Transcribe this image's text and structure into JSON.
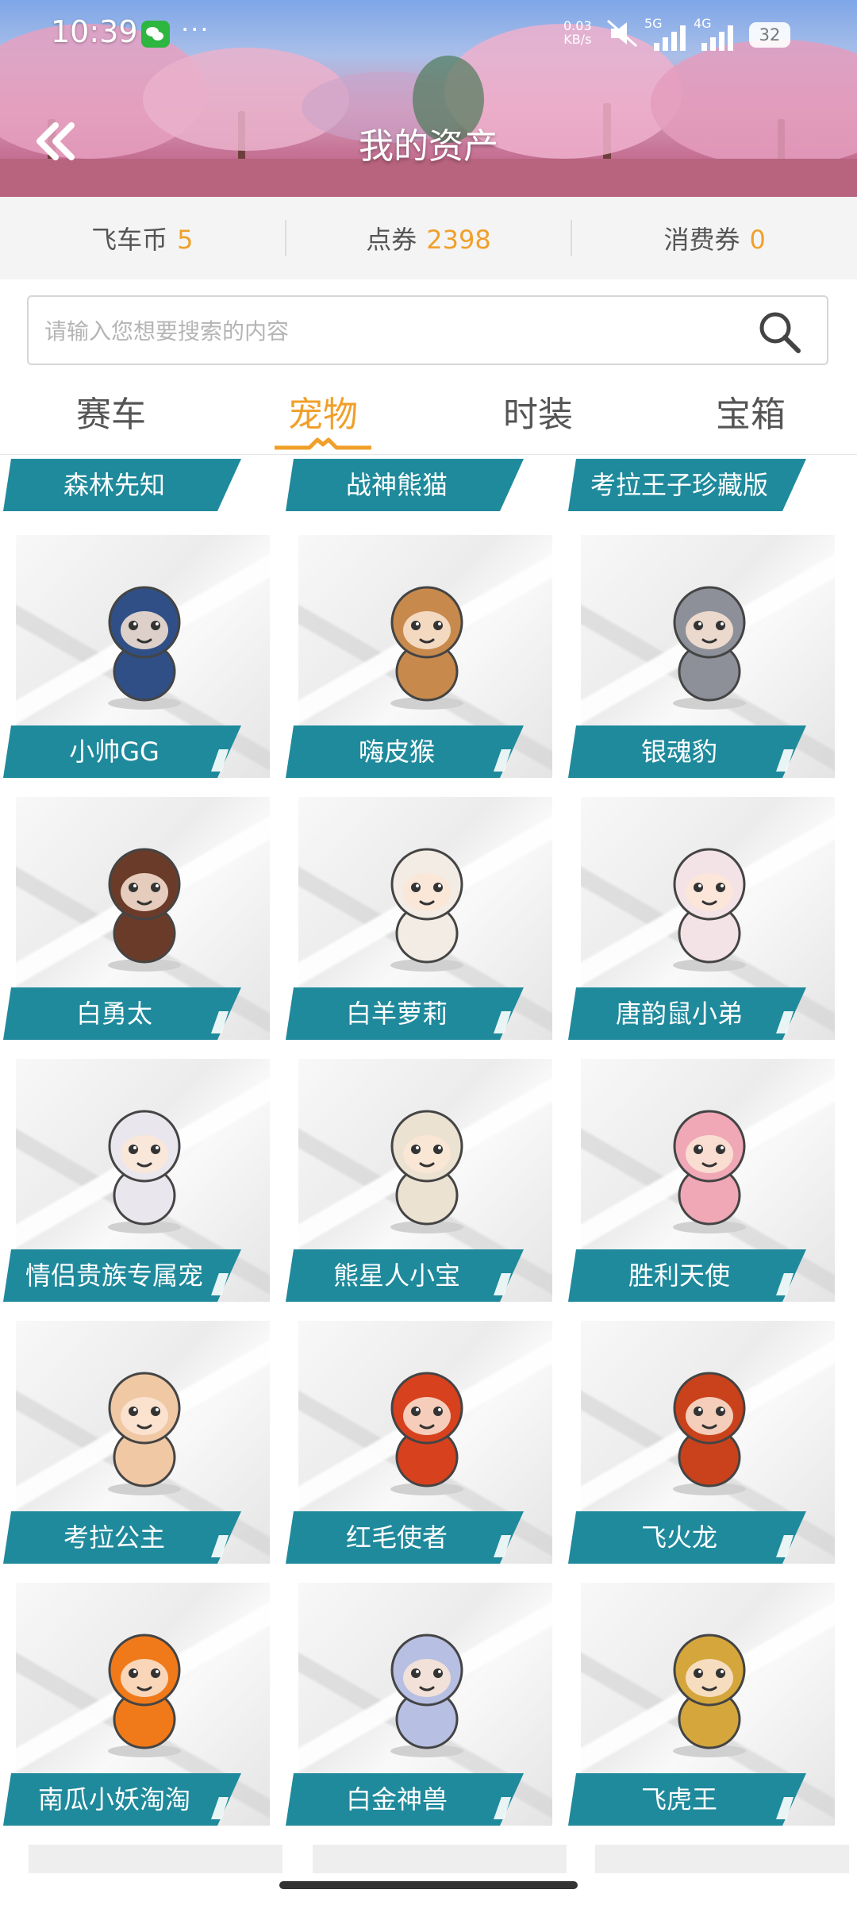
{
  "status_bar": {
    "time": "10:39",
    "dots": "···",
    "net_speed_value": "0.03",
    "net_speed_unit": "KB/s",
    "sig1": "5G",
    "sig2": "4G",
    "battery": "32"
  },
  "header": {
    "title": "我的资产"
  },
  "balance": [
    {
      "label": "飞车币",
      "value": "5"
    },
    {
      "label": "点券",
      "value": "2398"
    },
    {
      "label": "消费券",
      "value": "0"
    }
  ],
  "search": {
    "placeholder": "请输入您想要搜索的内容"
  },
  "tabs": [
    {
      "label": "赛车"
    },
    {
      "label": "宠物",
      "active": true
    },
    {
      "label": "时装"
    },
    {
      "label": "宝箱"
    }
  ],
  "top_row": [
    "森林先知",
    "战神熊猫",
    "考拉王子珍藏版"
  ],
  "pets": [
    {
      "name": "小帅GG",
      "icon": "baby-boy-pet-icon",
      "color": "#2f4f86"
    },
    {
      "name": "嗨皮猴",
      "icon": "monkey-on-ball-pet-icon",
      "color": "#c88a4c"
    },
    {
      "name": "银魂豹",
      "icon": "robot-leopard-pet-icon",
      "color": "#8d9099"
    },
    {
      "name": "白勇太",
      "icon": "boy-in-shirt-pet-icon",
      "color": "#6b3b2a"
    },
    {
      "name": "白羊萝莉",
      "icon": "sheep-pet-icon",
      "color": "#f2ece4"
    },
    {
      "name": "唐韵鼠小弟",
      "icon": "mouse-pet-icon",
      "color": "#f3e3e6"
    },
    {
      "name": "情侣贵族专属宠",
      "icon": "white-hair-girl-pet-icon",
      "color": "#e9e6ee"
    },
    {
      "name": "熊星人小宝",
      "icon": "bear-baby-pet-icon",
      "color": "#ece2d2"
    },
    {
      "name": "胜利天使",
      "icon": "pink-hair-angel-pet-icon",
      "color": "#f0a8b6"
    },
    {
      "name": "考拉公主",
      "icon": "koala-pet-icon",
      "color": "#f0c8a4"
    },
    {
      "name": "红毛使者",
      "icon": "penguin-pet-icon",
      "color": "#d8411e"
    },
    {
      "name": "飞火龙",
      "icon": "fire-dragon-pet-icon",
      "color": "#c9421c"
    },
    {
      "name": "南瓜小妖淘淘",
      "icon": "pumpkin-pet-icon",
      "color": "#f07a1a"
    },
    {
      "name": "白金神兽",
      "icon": "silver-beast-pet-icon",
      "color": "#b7bfe3"
    },
    {
      "name": "飞虎王",
      "icon": "tiger-cub-pet-icon",
      "color": "#d4a63c"
    }
  ],
  "colors": {
    "accent_orange": "#f0a02a",
    "label_teal": "#1f8a9c"
  }
}
